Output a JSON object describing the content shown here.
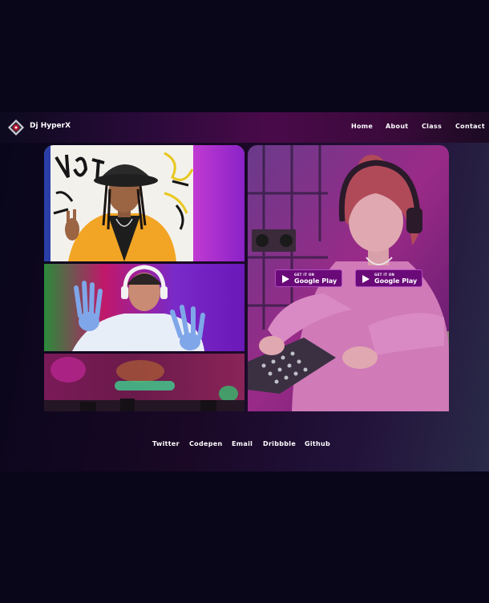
{
  "header": {
    "brand": "Dj HyperX",
    "nav": [
      "Home",
      "About",
      "Class",
      "Contact"
    ]
  },
  "store_buttons": [
    {
      "small": "GET IT ON",
      "big": "Google Play"
    },
    {
      "small": "GET IT ON",
      "big": "Google Play"
    }
  ],
  "footer": {
    "links": [
      "Twitter",
      "Codepen",
      "Email",
      "Dribbble",
      "Github"
    ]
  },
  "colors": {
    "page_bg": "#0a0619",
    "accent_purple": "#6a0a78",
    "text": "#ffffff"
  }
}
